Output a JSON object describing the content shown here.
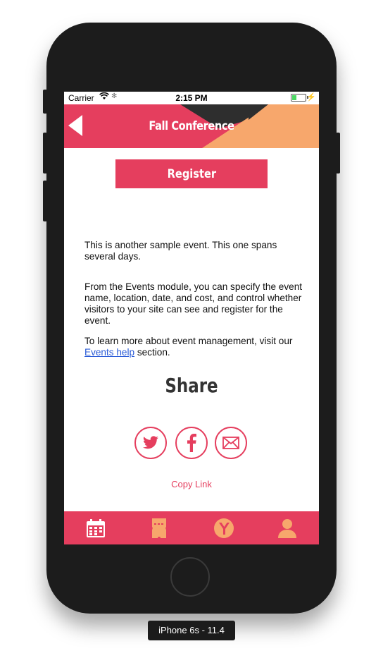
{
  "status_bar": {
    "carrier": "Carrier",
    "time": "2:15 PM"
  },
  "header": {
    "title": "Fall Conference",
    "colors": {
      "primary": "#e53e5e",
      "accent": "#f7a76c",
      "dark": "#2e2e2e"
    }
  },
  "register": {
    "label": "Register"
  },
  "content": {
    "paragraph_1": "This is another sample event. This one spans several days.",
    "paragraph_2": "From the Events module, you can specify the event name, location, date, and cost, and control whether visitors to your site can see and register for the event.",
    "paragraph_3_before": "To learn more about event management, visit our ",
    "paragraph_3_link": "Events help",
    "paragraph_3_after": " section."
  },
  "share": {
    "title": "Share",
    "buttons": [
      {
        "icon": "twitter-icon"
      },
      {
        "icon": "facebook-icon"
      },
      {
        "icon": "mail-icon"
      }
    ],
    "copy_link": "Copy Link"
  },
  "tab_bar": {
    "tabs": [
      {
        "icon": "calendar-icon"
      },
      {
        "icon": "ticket-icon"
      },
      {
        "icon": "brand-y-icon"
      },
      {
        "icon": "profile-icon"
      }
    ]
  },
  "device_label": "iPhone 6s - 11.4"
}
